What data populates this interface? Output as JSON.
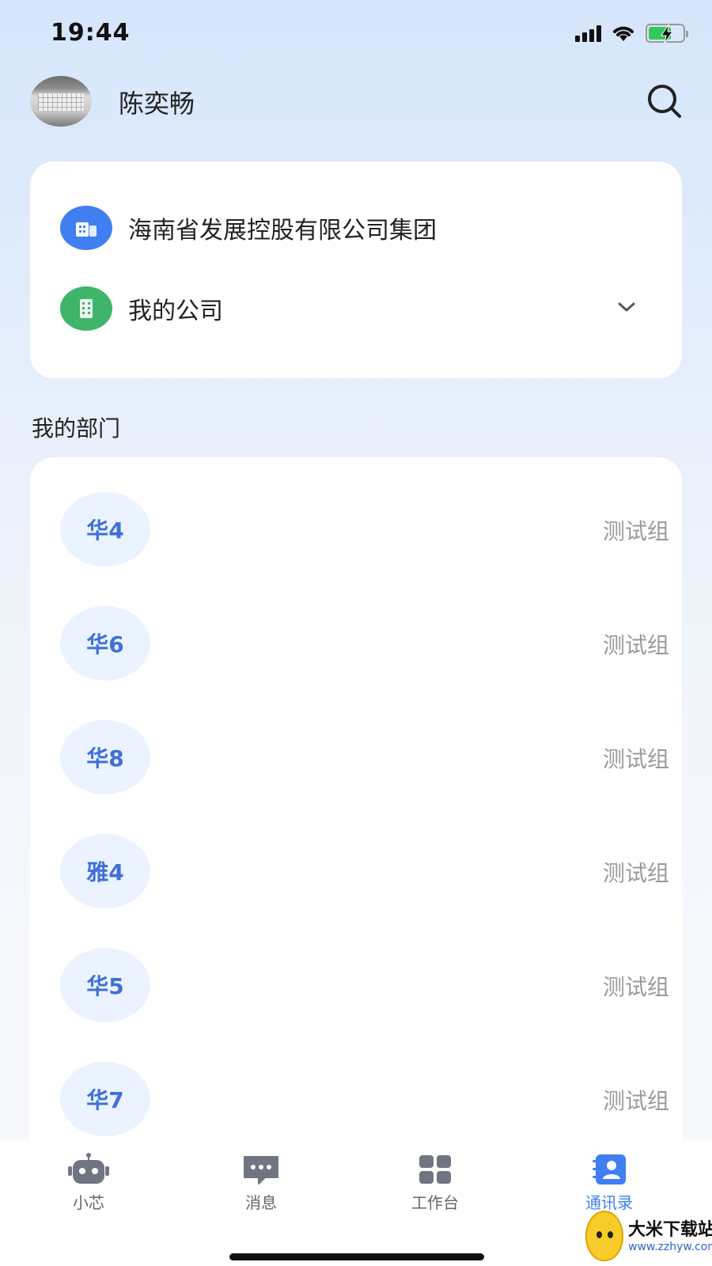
{
  "status_bar": {
    "time": "19:44"
  },
  "header": {
    "user_name": "陈奕畅"
  },
  "companies": [
    {
      "name": "海南省发展控股有限公司集团",
      "icon": "building-icon",
      "color": "#3f7ff2"
    },
    {
      "name": "我的公司",
      "icon": "office-building-icon",
      "color": "#3eb56a"
    }
  ],
  "departments": {
    "title": "我的部门",
    "items": [
      {
        "badge": "华4",
        "group": "测试组"
      },
      {
        "badge": "华6",
        "group": "测试组"
      },
      {
        "badge": "华8",
        "group": "测试组"
      },
      {
        "badge": "雅4",
        "group": "测试组"
      },
      {
        "badge": "华5",
        "group": "测试组"
      },
      {
        "badge": "华7",
        "group": "测试组"
      }
    ]
  },
  "nav": {
    "items": [
      {
        "label": "小芯",
        "icon": "robot-icon"
      },
      {
        "label": "消息",
        "icon": "chat-bubble-icon"
      },
      {
        "label": "工作台",
        "icon": "grid-icon"
      },
      {
        "label": "通讯录",
        "icon": "contacts-icon",
        "active": true
      }
    ],
    "active_color": "#3f7ff2"
  },
  "watermark": {
    "title": "大米下载站",
    "url": "www.zzhyw.com"
  }
}
